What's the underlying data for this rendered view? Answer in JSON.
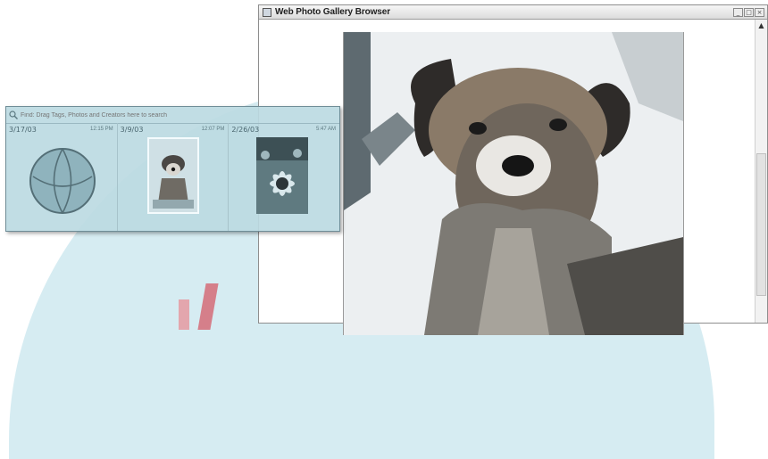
{
  "window": {
    "title": "Web Photo Gallery Browser",
    "controls": [
      "minimize-icon",
      "maximize-icon",
      "close-icon"
    ]
  },
  "viewer": {
    "image": "dog-photo"
  },
  "search": {
    "placeholder": "Find: Drag Tags, Photos and Creators here to search"
  },
  "thumbnails": [
    {
      "date": "3/17/03",
      "time": "12:15 PM",
      "image": "basketball"
    },
    {
      "date": "3/9/03",
      "time": "12:07 PM",
      "image": "dog"
    },
    {
      "date": "2/26/03",
      "time": "5:47 AM",
      "image": "sunflower"
    }
  ],
  "colors": {
    "overlay": "#c8e6ee",
    "panel": "#bcdae2",
    "accent": "#d57f8a"
  }
}
